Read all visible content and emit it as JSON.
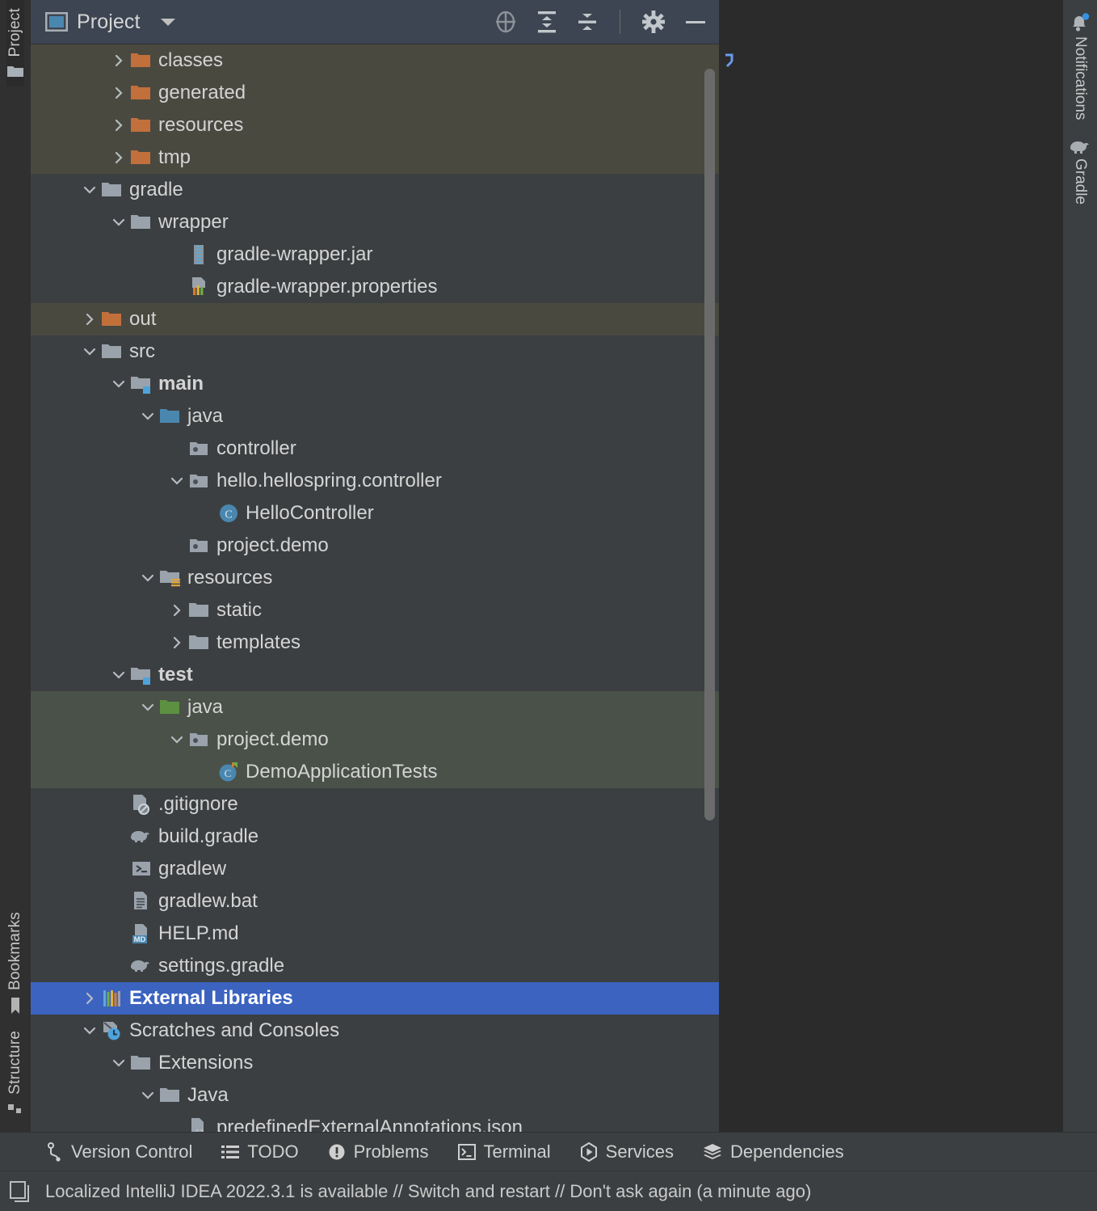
{
  "window": {
    "accent_selection": "#3C63C0",
    "header_bg": "#3C4551",
    "panel_bg": "#3C3F41",
    "editor_bg": "#2B2B2B",
    "excluded_highlight": "#4A4940",
    "test_highlight": "#4A5149"
  },
  "left_rail": {
    "top": [
      {
        "label": "Project",
        "icon": "project-folder-icon",
        "active": true
      }
    ],
    "bottom": [
      {
        "label": "Bookmarks",
        "icon": "bookmark-icon",
        "active": false
      },
      {
        "label": "Structure",
        "icon": "structure-icon",
        "active": false
      }
    ]
  },
  "right_rail": [
    {
      "label": "Notifications",
      "icon": "bell-icon",
      "badge": true
    },
    {
      "label": "Gradle",
      "icon": "gradle-elephant-icon",
      "badge": false
    }
  ],
  "panel": {
    "title": "Project",
    "title_icon": "project-window-icon",
    "dropdown_icon": "chevron-down-icon",
    "toolbar": [
      {
        "name": "select-opened-file-button",
        "icon": "crosshair-target-icon"
      },
      {
        "name": "expand-all-button",
        "icon": "expand-all-icon"
      },
      {
        "name": "collapse-all-button",
        "icon": "collapse-all-icon"
      },
      {
        "name": "settings-button",
        "icon": "gear-icon"
      },
      {
        "name": "hide-button",
        "icon": "minimize-icon"
      }
    ]
  },
  "tree": [
    {
      "label": "classes",
      "indent": 2,
      "twisty": "right",
      "icon": "folder-orange",
      "state": "excluded"
    },
    {
      "label": "generated",
      "indent": 2,
      "twisty": "right",
      "icon": "folder-orange",
      "state": "excluded"
    },
    {
      "label": "resources",
      "indent": 2,
      "twisty": "right",
      "icon": "folder-orange",
      "state": "excluded"
    },
    {
      "label": "tmp",
      "indent": 2,
      "twisty": "right",
      "icon": "folder-orange",
      "state": "excluded"
    },
    {
      "label": "gradle",
      "indent": 1,
      "twisty": "down",
      "icon": "folder-gray",
      "state": "normal"
    },
    {
      "label": "wrapper",
      "indent": 2,
      "twisty": "down",
      "icon": "folder-gray",
      "state": "normal"
    },
    {
      "label": "gradle-wrapper.jar",
      "indent": 4,
      "twisty": "none",
      "icon": "jar-file",
      "state": "normal"
    },
    {
      "label": "gradle-wrapper.properties",
      "indent": 4,
      "twisty": "none",
      "icon": "properties-file",
      "state": "normal"
    },
    {
      "label": "out",
      "indent": 1,
      "twisty": "right",
      "icon": "folder-orange",
      "state": "excluded"
    },
    {
      "label": "src",
      "indent": 1,
      "twisty": "down",
      "icon": "folder-gray",
      "state": "normal"
    },
    {
      "label": "main",
      "indent": 2,
      "twisty": "down",
      "icon": "folder-module",
      "state": "normal",
      "bold": true
    },
    {
      "label": "java",
      "indent": 3,
      "twisty": "down",
      "icon": "folder-source",
      "state": "normal"
    },
    {
      "label": "controller",
      "indent": 4,
      "twisty": "none",
      "icon": "package",
      "state": "normal"
    },
    {
      "label": "hello.hellospring.controller",
      "indent": 4,
      "twisty": "down",
      "icon": "package",
      "state": "normal"
    },
    {
      "label": "HelloController",
      "indent": 5,
      "twisty": "none",
      "icon": "java-class",
      "state": "normal"
    },
    {
      "label": "project.demo",
      "indent": 4,
      "twisty": "none",
      "icon": "package",
      "state": "normal"
    },
    {
      "label": "resources",
      "indent": 3,
      "twisty": "down",
      "icon": "folder-resource",
      "state": "normal"
    },
    {
      "label": "static",
      "indent": 4,
      "twisty": "right",
      "icon": "folder-gray",
      "state": "normal"
    },
    {
      "label": "templates",
      "indent": 4,
      "twisty": "right",
      "icon": "folder-gray",
      "state": "normal"
    },
    {
      "label": "test",
      "indent": 2,
      "twisty": "down",
      "icon": "folder-module",
      "state": "normal",
      "bold": true
    },
    {
      "label": "java",
      "indent": 3,
      "twisty": "down",
      "icon": "folder-test",
      "state": "test"
    },
    {
      "label": "project.demo",
      "indent": 4,
      "twisty": "down",
      "icon": "package",
      "state": "test"
    },
    {
      "label": "DemoApplicationTests",
      "indent": 5,
      "twisty": "none",
      "icon": "java-test-class",
      "state": "test"
    },
    {
      "label": ".gitignore",
      "indent": 2,
      "twisty": "none",
      "icon": "gitignore-file",
      "state": "normal"
    },
    {
      "label": "build.gradle",
      "indent": 2,
      "twisty": "none",
      "icon": "gradle-file",
      "state": "normal"
    },
    {
      "label": "gradlew",
      "indent": 2,
      "twisty": "none",
      "icon": "script-file",
      "state": "normal"
    },
    {
      "label": "gradlew.bat",
      "indent": 2,
      "twisty": "none",
      "icon": "text-file",
      "state": "normal"
    },
    {
      "label": "HELP.md",
      "indent": 2,
      "twisty": "none",
      "icon": "markdown-file",
      "state": "normal"
    },
    {
      "label": "settings.gradle",
      "indent": 2,
      "twisty": "none",
      "icon": "gradle-file",
      "state": "normal"
    },
    {
      "label": "External Libraries",
      "indent": 1,
      "twisty": "right",
      "icon": "libraries",
      "state": "selected",
      "bold": true
    },
    {
      "label": "Scratches and Consoles",
      "indent": 1,
      "twisty": "down",
      "icon": "scratches",
      "state": "normal"
    },
    {
      "label": "Extensions",
      "indent": 2,
      "twisty": "down",
      "icon": "folder-gray",
      "state": "normal"
    },
    {
      "label": "Java",
      "indent": 3,
      "twisty": "down",
      "icon": "folder-gray",
      "state": "normal"
    },
    {
      "label": "predefinedExternalAnnotations.json",
      "indent": 4,
      "twisty": "none",
      "icon": "json-file",
      "state": "normal"
    }
  ],
  "tool_strip": [
    {
      "label": "Version Control",
      "icon": "branch-icon"
    },
    {
      "label": "TODO",
      "icon": "list-icon"
    },
    {
      "label": "Problems",
      "icon": "exclamation-circle-icon"
    },
    {
      "label": "Terminal",
      "icon": "terminal-icon"
    },
    {
      "label": "Services",
      "icon": "play-hex-icon"
    },
    {
      "label": "Dependencies",
      "icon": "layers-icon"
    }
  ],
  "status_bar": {
    "icon": "ide-window-icon",
    "message": "Localized IntelliJ IDEA 2022.3.1 is available // Switch and restart // Don't ask again (a minute ago)"
  }
}
